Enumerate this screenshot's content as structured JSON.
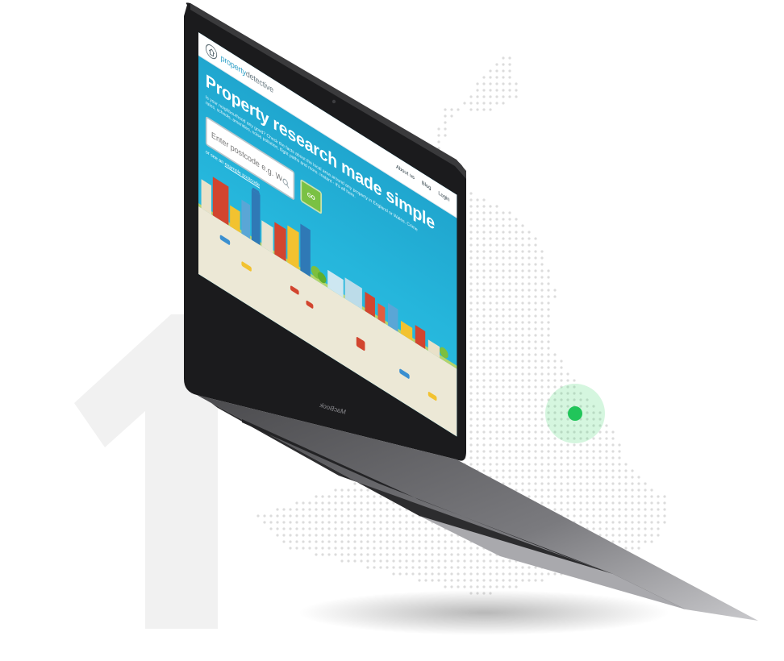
{
  "site": {
    "logo_name_bold": "property",
    "logo_name_thin": "detective",
    "nav": [
      {
        "label": "About us"
      },
      {
        "label": "Blog"
      },
      {
        "label": "Login"
      }
    ],
    "hero_title": "Property research made simple",
    "hero_subtitle": "Is your neighbourhood any good? Check the facts about the local area around any property in England or Wales. Crime rates, schools, amenities, noise pollution, flight paths and more. Instant - it's all here.",
    "search": {
      "placeholder": "Enter postcode e.g. W6 5HB",
      "go_label": "GO"
    },
    "example_prefix": "or see an",
    "example_link": "example postcode"
  },
  "laptop_brand": "MacBook",
  "colors": {
    "screen_blue": "#25b5db",
    "go_green": "#7ac143",
    "marker_green": "#21c55a",
    "laptop_body": "#3a3a3c"
  },
  "icons": {
    "logo": "house-icon",
    "search": "search-icon",
    "marker": "location-dot-icon"
  }
}
